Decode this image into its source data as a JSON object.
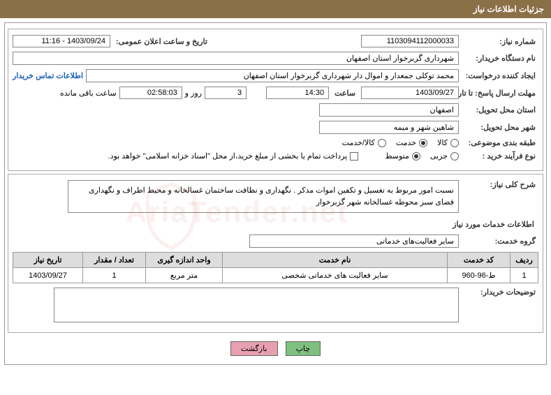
{
  "header": {
    "title": "جزئیات اطلاعات نیاز"
  },
  "fields": {
    "need_no_label": "شماره نیاز:",
    "need_no": "1103094112000033",
    "announce_label": "تاریخ و ساعت اعلان عمومی:",
    "announce_value": "1403/09/24 - 11:16",
    "buyer_org_label": "نام دستگاه خریدار:",
    "buyer_org": "شهرداری گزبرخوار استان اصفهان",
    "requester_label": "ایجاد کننده درخواست:",
    "requester": "محمد توکلی جمعدار و اموال دار شهرداری گزبرخوار استان اصفهان",
    "contact_link": "اطلاعات تماس خریدار",
    "deadline_label": "مهلت ارسال پاسخ: تا تاریخ:",
    "deadline_date": "1403/09/27",
    "time_label": "ساعت",
    "deadline_time": "14:30",
    "days": "3",
    "days_suffix": "روز و",
    "countdown": "02:58:03",
    "countdown_suffix": "ساعت باقی مانده",
    "delivery_province_label": "استان محل تحویل:",
    "delivery_province": "اصفهان",
    "delivery_city_label": "شهر محل تحویل:",
    "delivery_city": "شاهین شهر و میمه",
    "category_label": "طبقه بندی موضوعی:",
    "cat_goods": "کالا",
    "cat_service": "خدمت",
    "cat_both": "کالا/خدمت",
    "process_label": "نوع فرآیند خرید :",
    "proc_small": "جزیی",
    "proc_medium": "متوسط",
    "payment_note": "پرداخت تمام یا بخشی از مبلغ خرید،از محل \"اسناد خزانه اسلامی\" خواهد بود.",
    "general_desc_label": "شرح کلی نیاز:",
    "general_desc": "نسبت امور مربوط به تغسیل و تکفین اموات مذکر . نگهداری و نظافت ساختمان غسالخانه و محیط اطراف و نگهداری فضای سبز محوطه غسالخانه شهر گزبرخوار",
    "services_header": "اطلاعات خدمات مورد نیاز",
    "service_group_label": "گروه خدمت:",
    "service_group": "سایر فعالیت‌های خدماتی",
    "buyer_comment_label": "توضیحات خریدار:"
  },
  "table": {
    "headers": [
      "ردیف",
      "کد خدمت",
      "نام خدمت",
      "واحد اندازه گیری",
      "تعداد / مقدار",
      "تاریخ نیاز"
    ],
    "rows": [
      {
        "idx": "1",
        "code": "ط-96-960",
        "name": "سایر فعالیت های خدماتی شخصی",
        "unit": "متر مربع",
        "qty": "1",
        "date": "1403/09/27"
      }
    ]
  },
  "buttons": {
    "print": "چاپ",
    "back": "بازگشت"
  },
  "watermark": "AriaTender.net"
}
